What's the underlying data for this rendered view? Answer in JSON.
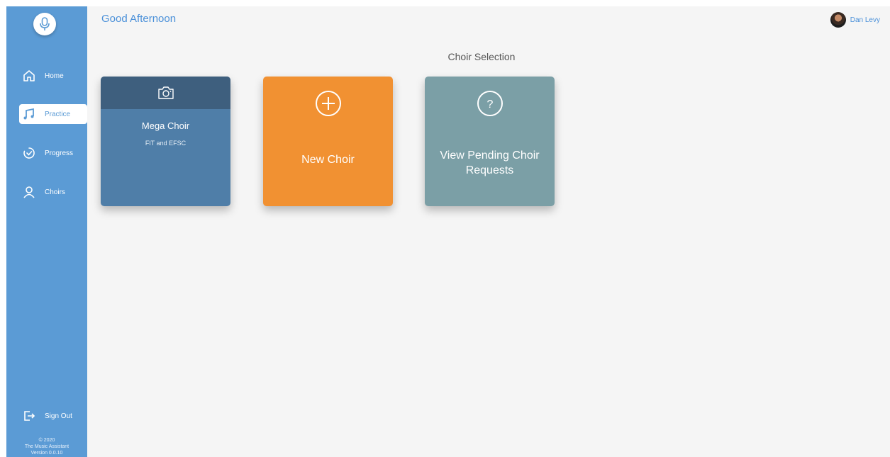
{
  "app": {
    "footer": {
      "copyright": "© 2020",
      "name": "The Music Assistant",
      "version": "Version 0.0.10"
    }
  },
  "sidebar": {
    "items": [
      {
        "label": "Home",
        "icon": "home-icon",
        "active": false
      },
      {
        "label": "Practice",
        "icon": "music-note-icon",
        "active": true
      },
      {
        "label": "Progress",
        "icon": "progress-icon",
        "active": false
      },
      {
        "label": "Choirs",
        "icon": "person-icon",
        "active": false
      }
    ],
    "signout_label": "Sign Out"
  },
  "header": {
    "greeting": "Good Afternoon",
    "user_name": "Dan Levy"
  },
  "main": {
    "section_title": "Choir Selection",
    "cards": [
      {
        "title": "Mega Choir",
        "subtitle": "FIT and EFSC",
        "icon": "camera-icon",
        "color": "#4f7ea8"
      },
      {
        "title": "New Choir",
        "icon": "plus-circle-icon",
        "color": "#f19132"
      },
      {
        "title": "View Pending Choir Requests",
        "icon": "question-circle-icon",
        "color": "#7b9fa6"
      }
    ]
  },
  "colors": {
    "sidebar": "#5b9bd5",
    "accent": "#4a90d9",
    "background": "#f5f5f5"
  }
}
